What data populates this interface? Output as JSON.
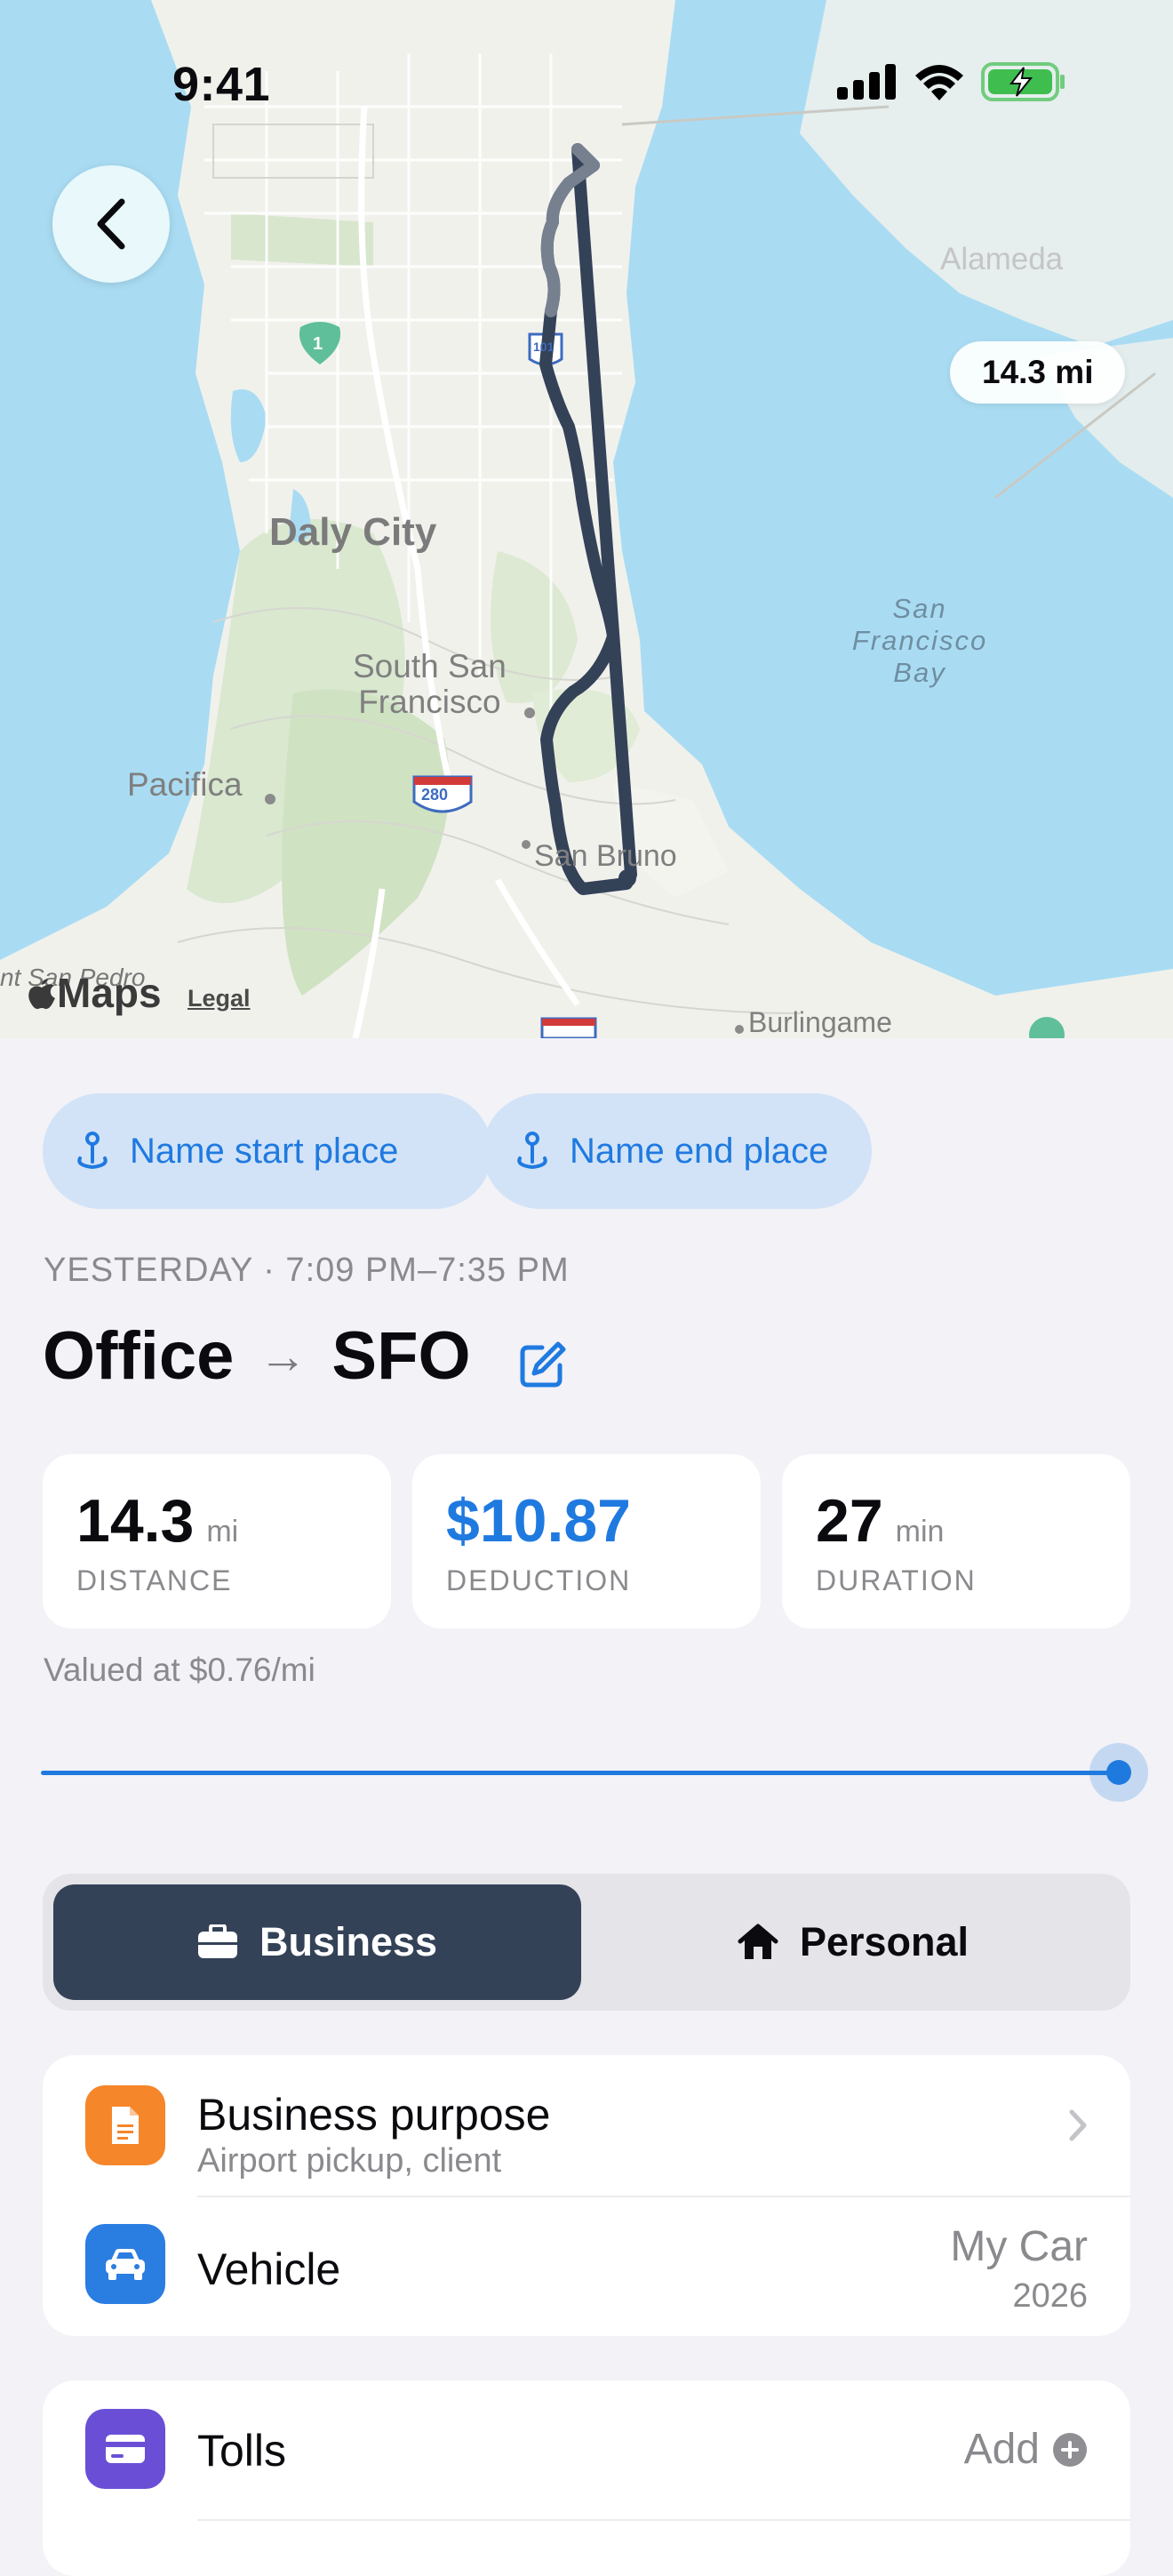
{
  "status_bar": {
    "time": "9:41"
  },
  "map": {
    "distance_pill": "14.3 mi",
    "labels": {
      "alameda": "Alameda",
      "daly_city": "Daly City",
      "south_sf_line1": "South San",
      "south_sf_line2": "Francisco",
      "bay_line1": "San",
      "bay_line2": "Francisco",
      "bay_line3": "Bay",
      "pacifica": "Pacifica",
      "san_bruno": "San Bruno",
      "burlingame": "Burlingame",
      "san_pedro": "nt San Pedro",
      "hwy1": "1",
      "hwy280": "280",
      "hwy101": "101"
    },
    "attribution": {
      "maps": "Maps",
      "legal": "Legal"
    }
  },
  "place_chips": {
    "start": "Name start place",
    "end": "Name end place"
  },
  "trip": {
    "date_line": "YESTERDAY · 7:09 PM–7:35 PM",
    "origin": "Office",
    "arrow": "→",
    "destination": "SFO"
  },
  "stats": {
    "distance": {
      "value": "14.3",
      "unit": "mi",
      "label": "DISTANCE"
    },
    "deduction": {
      "value": "$10.87",
      "label": "DEDUCTION"
    },
    "duration": {
      "value": "27",
      "unit": "min",
      "label": "DURATION"
    }
  },
  "valued_at": "Valued at $0.76/mi",
  "trip_slider": {
    "fraction": 1.0
  },
  "classification": {
    "business": "Business",
    "personal": "Personal",
    "selected": "business"
  },
  "details": {
    "purpose": {
      "title": "Business purpose",
      "subtitle": "Airport pickup, client"
    },
    "vehicle": {
      "title": "Vehicle",
      "name": "My Car",
      "year": "2026"
    },
    "tolls": {
      "title": "Tolls",
      "action": "Add"
    }
  },
  "colors": {
    "accent": "#1f7ae0",
    "business_selected": "#344258",
    "purpose_icon": "#f5862a",
    "vehicle_icon": "#2a7de1",
    "tolls_icon": "#6a4fd6"
  },
  "icons": {
    "back": "chevron-left-icon",
    "chip": "map-pin-icon",
    "edit": "edit-icon",
    "business": "briefcase-icon",
    "personal": "house-icon",
    "purpose": "document-icon",
    "vehicle": "car-icon",
    "tolls": "credit-card-icon",
    "add": "plus-circle-icon",
    "disclosure": "chevron-right-icon"
  }
}
